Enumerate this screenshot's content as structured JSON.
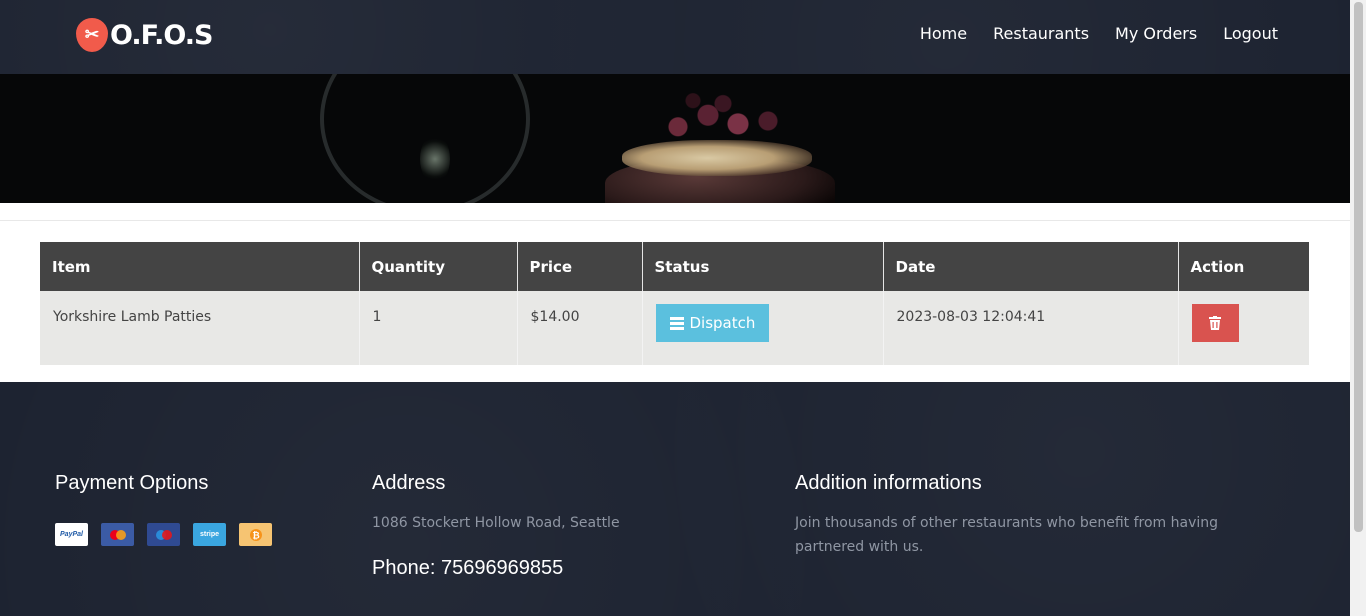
{
  "header": {
    "logo_text": "O.F.O.S",
    "nav": [
      "Home",
      "Restaurants",
      "My Orders",
      "Logout"
    ]
  },
  "orders_table": {
    "columns": [
      "Item",
      "Quantity",
      "Price",
      "Status",
      "Date",
      "Action"
    ],
    "rows": [
      {
        "item": "Yorkshire Lamb Patties",
        "quantity": "1",
        "price": "$14.00",
        "status": "Dispatch",
        "date": "2023-08-03 12:04:41"
      }
    ]
  },
  "footer": {
    "payment_title": "Payment Options",
    "payment_methods": [
      "PayPal",
      "mastercard",
      "maestro",
      "stripe",
      "bitcoin"
    ],
    "address_title": "Address",
    "address": "1086 Stockert Hollow Road, Seattle",
    "phone": "Phone: 75696969855",
    "info_title": "Addition informations",
    "info_text": "Join thousands of other restaurants who benefit from having partnered with us."
  },
  "colors": {
    "header_bg": "#1d2331",
    "accent": "#f15b4b",
    "dispatch_button": "#5bc0de",
    "delete_button": "#d9534f",
    "table_header": "#444444"
  }
}
